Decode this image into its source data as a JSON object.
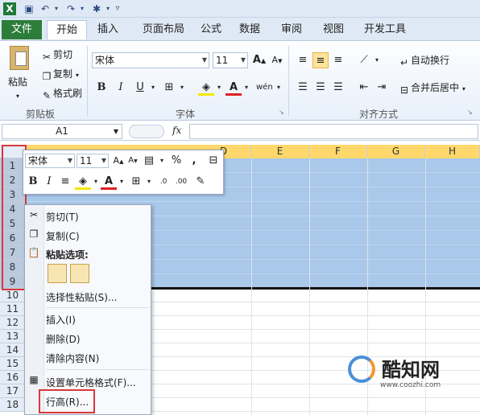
{
  "tabs": {
    "file": "文件",
    "items": [
      "开始",
      "插入",
      "页面布局",
      "公式",
      "数据",
      "审阅",
      "视图",
      "开发工具"
    ]
  },
  "ribbon": {
    "clipboard": {
      "paste": "粘贴",
      "cut": "剪切",
      "copy": "复制",
      "format_painter": "格式刷",
      "label": "剪贴板"
    },
    "font": {
      "name": "宋体",
      "size": "11",
      "label": "字体"
    },
    "alignment": {
      "wrap": "自动换行",
      "merge": "合并后居中",
      "label": "对齐方式"
    }
  },
  "formula_bar": {
    "name_box": "A1",
    "fx": "fx"
  },
  "columns": [
    "D",
    "E",
    "F",
    "G",
    "H"
  ],
  "rows": [
    "1",
    "2",
    "3",
    "4",
    "5",
    "6",
    "7",
    "8",
    "9",
    "10",
    "11",
    "12",
    "13",
    "14",
    "15",
    "16",
    "17",
    "18"
  ],
  "mini_toolbar": {
    "font": "宋体",
    "size": "11",
    "percent": "%",
    "comma": ","
  },
  "context_menu": {
    "cut": "剪切(T)",
    "copy": "复制(C)",
    "paste_options": "粘贴选项:",
    "paste_special": "选择性粘贴(S)...",
    "insert": "插入(I)",
    "delete": "删除(D)",
    "clear": "清除内容(N)",
    "format_cells": "设置单元格格式(F)...",
    "row_height": "行高(R)..."
  },
  "watermark": {
    "title": "酷知网",
    "url": "www.coozhi.com"
  }
}
